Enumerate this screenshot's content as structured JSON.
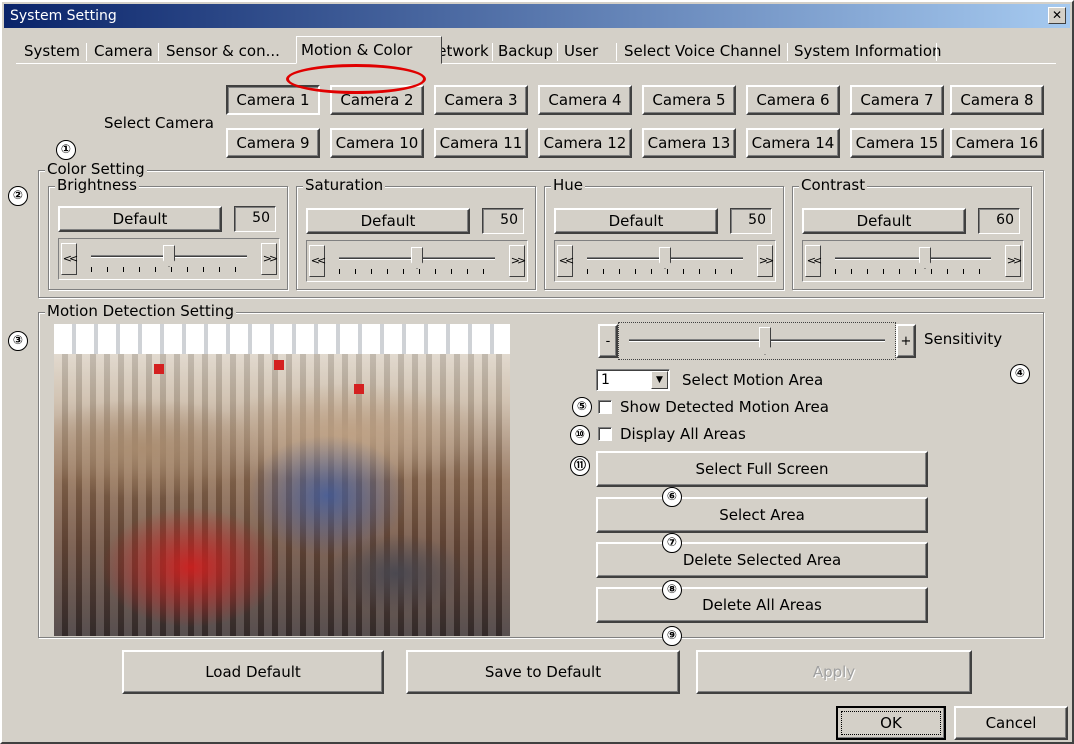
{
  "window": {
    "title": "System Setting",
    "close_glyph": "✕"
  },
  "tabs": [
    {
      "label": "System"
    },
    {
      "label": "Camera"
    },
    {
      "label": "Sensor & con..."
    },
    {
      "label": "Motion & Color",
      "active": true
    },
    {
      "label": "Network"
    },
    {
      "label": "Backup"
    },
    {
      "label": "User"
    },
    {
      "label": "Select Voice Channel"
    },
    {
      "label": "System Information"
    }
  ],
  "camera_select": {
    "label": "Select Camera",
    "cameras": [
      "Camera 1",
      "Camera 2",
      "Camera 3",
      "Camera 4",
      "Camera 5",
      "Camera 6",
      "Camera 7",
      "Camera 8",
      "Camera 9",
      "Camera 10",
      "Camera 11",
      "Camera 12",
      "Camera 13",
      "Camera 14",
      "Camera 15",
      "Camera 16"
    ],
    "selected": "Camera 1"
  },
  "color_setting": {
    "title": "Color Setting",
    "default_label": "Default",
    "left_arrow": "<<",
    "right_arrow": ">>",
    "controls": [
      {
        "name": "Brightness",
        "value": "50"
      },
      {
        "name": "Saturation",
        "value": "50"
      },
      {
        "name": "Hue",
        "value": "50"
      },
      {
        "name": "Contrast",
        "value": "60"
      }
    ]
  },
  "motion": {
    "title": "Motion Detection Setting",
    "minus": "-",
    "plus": "+",
    "sensitivity_label": "Sensitivity",
    "area_value": "1",
    "dropdown_glyph": "▼",
    "select_area_label": "Select Motion Area",
    "show_detected_label": "Show Detected Motion Area",
    "display_all_label": "Display All Areas",
    "buttons": {
      "full_screen": "Select Full Screen",
      "select_area": "Select Area",
      "delete_selected": "Delete Selected Area",
      "delete_all": "Delete All Areas"
    }
  },
  "footer": {
    "load_default": "Load Default",
    "save_default": "Save to Default",
    "apply": "Apply",
    "ok": "OK",
    "cancel": "Cancel"
  },
  "markers": [
    "①",
    "②",
    "③",
    "④",
    "⑤",
    "⑥",
    "⑦",
    "⑧",
    "⑨",
    "⑩",
    "⑪"
  ],
  "colors": {
    "title_start": "#0a246a",
    "title_end": "#a6caf0",
    "face": "#d4d0c8",
    "annotation": "#e00000"
  }
}
